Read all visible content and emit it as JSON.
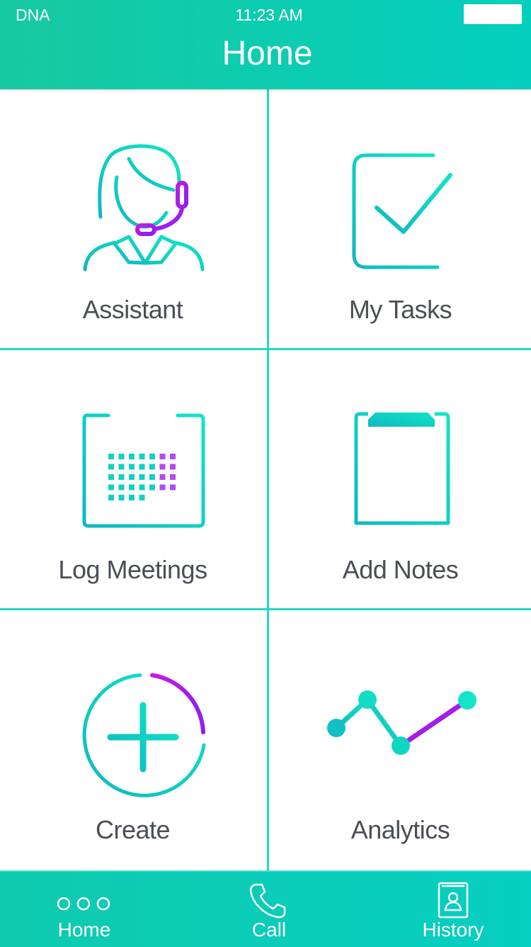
{
  "status_bar": {
    "carrier": "DNA",
    "time": "11:23 AM"
  },
  "header": {
    "title": "Home"
  },
  "tiles": [
    {
      "label": "Assistant",
      "icon": "headset-agent-icon"
    },
    {
      "label": "My Tasks",
      "icon": "checkbox-check-icon"
    },
    {
      "label": "Log Meetings",
      "icon": "calendar-icon"
    },
    {
      "label": "Add Notes",
      "icon": "clipboard-notes-icon"
    },
    {
      "label": "Create",
      "icon": "plus-circle-icon"
    },
    {
      "label": "Analytics",
      "icon": "line-graph-icon"
    }
  ],
  "tab_bar": {
    "items": [
      {
        "label": "Home",
        "icon": "three-dots-icon"
      },
      {
        "label": "Call",
        "icon": "phone-icon"
      },
      {
        "label": "History",
        "icon": "contact-book-icon"
      }
    ]
  },
  "colors": {
    "accent": "#04cfbf",
    "teal_light": "#0de0c9",
    "teal_dark": "#10bdbf",
    "purple": "#a51ce8",
    "label": "#4a4f55"
  }
}
